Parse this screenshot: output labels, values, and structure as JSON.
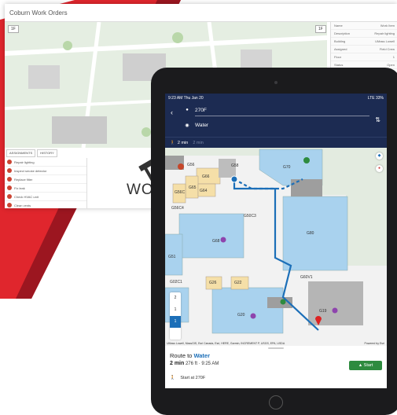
{
  "desktop": {
    "title": "Coburn Work Orders",
    "tabs": [
      "ASSIGNMENTS",
      "HISTORY"
    ],
    "list_items": [
      "Repair lighting",
      "Inspect smoke detector",
      "Replace filter",
      "Fix leak",
      "Check HVAC unit",
      "Clean vents"
    ],
    "work_label": "WORK",
    "map_buttons": [
      "1F",
      "1F"
    ],
    "detail_rows": [
      {
        "k": "Name",
        "v": "Work Item"
      },
      {
        "k": "Description",
        "v": "Repair lighting"
      },
      {
        "k": "Building",
        "v": "UMass Lowell"
      },
      {
        "k": "Assigned",
        "v": "Field Crew"
      },
      {
        "k": "Floor",
        "v": "1"
      },
      {
        "k": "Status",
        "v": "Open"
      }
    ]
  },
  "tablet": {
    "status_time": "9:23 AM  Thu Jan 20",
    "status_right": "LTE 33%",
    "origin": "270F",
    "destination": "Water",
    "mode_active": "2 min",
    "mode_inactive": "2 min",
    "rooms": [
      "G70",
      "G68",
      "G66",
      "G65",
      "G64",
      "G56C",
      "G56",
      "G56C4",
      "G58",
      "G50",
      "G51",
      "G50S",
      "G80",
      "G60V1",
      "G22",
      "G26",
      "G20",
      "G19",
      "G02C1",
      "G67"
    ],
    "floors": [
      "2",
      "1",
      "1"
    ],
    "attribution": "UMass Lowell, MassGIS, Esri Canada, Esri, HERE, Garmin, INCREMENT P, USGS, EPA, USDA",
    "powered_by": "Powered by Esri",
    "route_label": "Route to",
    "route_dest": "Water",
    "route_time": "2 min",
    "route_dist": "276 ft · 9:25 AM",
    "start_button": "▲ Start",
    "start_at": "Start at 270F"
  },
  "colors": {
    "nav_blue": "#1c2b52",
    "route_blue": "#1c6fb8",
    "start_green": "#2e8b3f",
    "brand_red": "#e0262d",
    "room_blue": "#a9d2ee",
    "room_tan": "#f5dfa8"
  }
}
